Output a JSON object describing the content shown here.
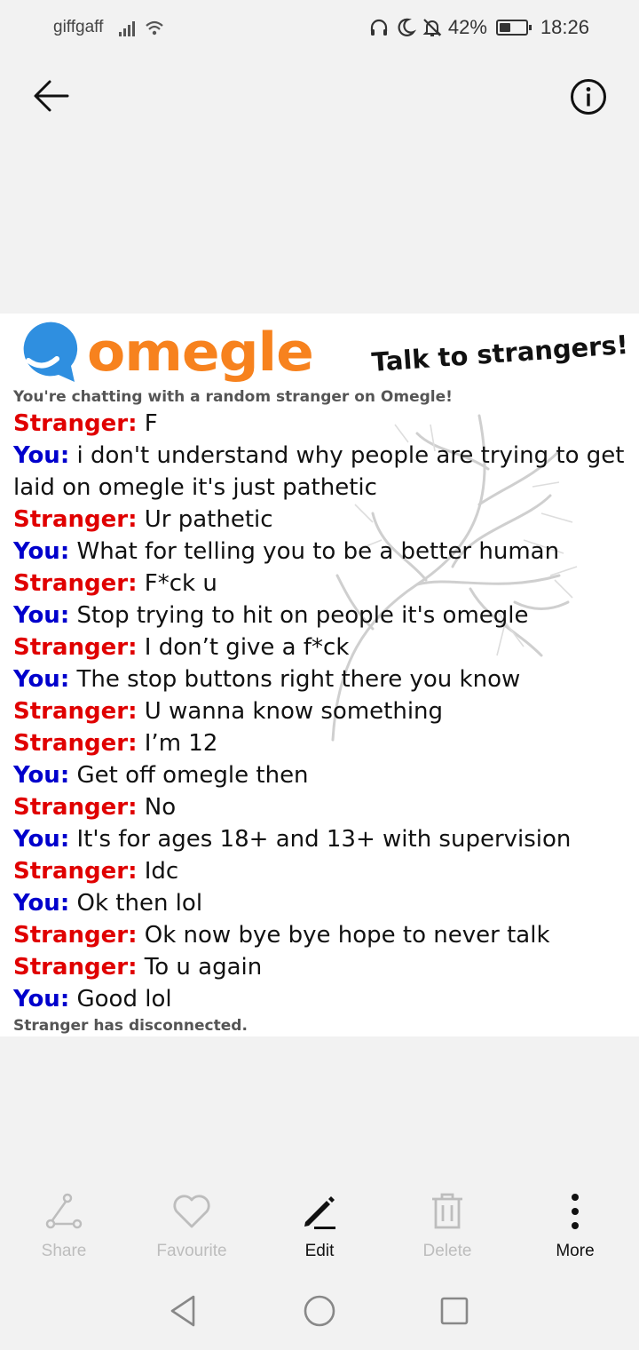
{
  "status_bar": {
    "carrier": "giffgaff",
    "battery_percent": "42%",
    "battery_level": 0.42,
    "time": "18:26",
    "icons": [
      "signal-icon",
      "wifi-icon",
      "headphones-icon",
      "moon-icon",
      "bell-off-icon",
      "battery-icon"
    ]
  },
  "top_bar": {
    "back_icon": "arrow-left-icon",
    "info_icon": "info-icon"
  },
  "screenshot": {
    "logo_text": "omegle",
    "tagline": "Talk to strangers!",
    "intro": "You're chatting with a random stranger on Omegle!",
    "messages": [
      {
        "who": "Stranger:",
        "text": " F"
      },
      {
        "who": "You:",
        "text": " i don't understand why people are trying to get laid on omegle it's just pathetic"
      },
      {
        "who": "Stranger:",
        "text": " Ur pathetic"
      },
      {
        "who": "You:",
        "text": " What for telling you to be a better human"
      },
      {
        "who": "Stranger:",
        "text": " F*ck u"
      },
      {
        "who": "You:",
        "text": " Stop trying to hit on people it's omegle"
      },
      {
        "who": "Stranger:",
        "text": " I don’t give a f*ck"
      },
      {
        "who": "You:",
        "text": " The stop buttons right there you know"
      },
      {
        "who": "Stranger:",
        "text": " U wanna know something"
      },
      {
        "who": "Stranger:",
        "text": " I’m 12"
      },
      {
        "who": "You:",
        "text": " Get off omegle then"
      },
      {
        "who": "Stranger:",
        "text": " No"
      },
      {
        "who": "You:",
        "text": " It's for ages 18+ and 13+ with supervision"
      },
      {
        "who": "Stranger:",
        "text": " Idc"
      },
      {
        "who": "You:",
        "text": " Ok then lol"
      },
      {
        "who": "Stranger:",
        "text": " Ok now bye bye hope to never talk"
      },
      {
        "who": "Stranger:",
        "text": " To u again"
      },
      {
        "who": "You:",
        "text": " Good lol"
      }
    ],
    "disconnected": "Stranger has disconnected."
  },
  "toolbar": {
    "share_label": "Share",
    "favourite_label": "Favourite",
    "edit_label": "Edit",
    "delete_label": "Delete",
    "more_label": "More"
  },
  "colors": {
    "stranger": "#e00000",
    "you": "#0000cc",
    "omegle_orange": "#f7821e",
    "omegle_blue": "#2f8fe0"
  }
}
